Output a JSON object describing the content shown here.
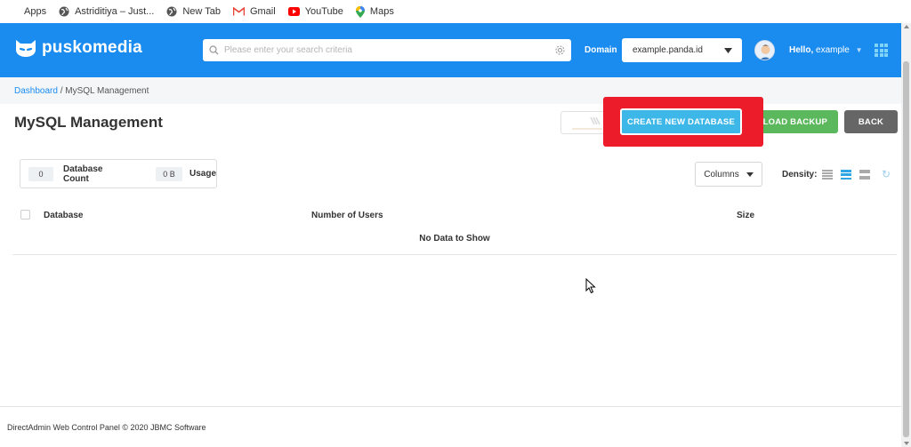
{
  "bookmarks": [
    {
      "label": "Apps",
      "icon": "apps-grid-icon"
    },
    {
      "label": "Astriditiya – Just...",
      "icon": "globe-icon"
    },
    {
      "label": "New Tab",
      "icon": "globe-icon"
    },
    {
      "label": "Gmail",
      "icon": "gmail-icon"
    },
    {
      "label": "YouTube",
      "icon": "youtube-icon"
    },
    {
      "label": "Maps",
      "icon": "maps-icon"
    }
  ],
  "header": {
    "brand": "puskomedia",
    "search_placeholder": "Please enter your search criteria",
    "domain_label": "Domain",
    "domain_value": "example.panda.id",
    "greeting": "Hello,",
    "user": "example",
    "colors": {
      "brand": "#1a8cf0",
      "accent": "#3cb7e8"
    }
  },
  "breadcrumb": {
    "root": "Dashboard",
    "separator": " / ",
    "current": "MySQL Management"
  },
  "page": {
    "title": "MySQL Management"
  },
  "actions": {
    "create": "CREATE NEW DATABASE",
    "upload": "PLOAD BACKUP",
    "back": "BACK",
    "highlight_color": "#ec1c2a"
  },
  "stats": {
    "count_value": "0",
    "count_label": "Database Count",
    "usage_value": "0 B",
    "usage_label": "Usage"
  },
  "tools": {
    "columns": "Columns",
    "density_label": "Density:"
  },
  "table": {
    "columns": [
      "Database",
      "Number of Users",
      "Size"
    ],
    "empty_message": "No Data to Show"
  },
  "footer": {
    "text": "DirectAdmin Web Control Panel © 2020 JBMC Software"
  }
}
